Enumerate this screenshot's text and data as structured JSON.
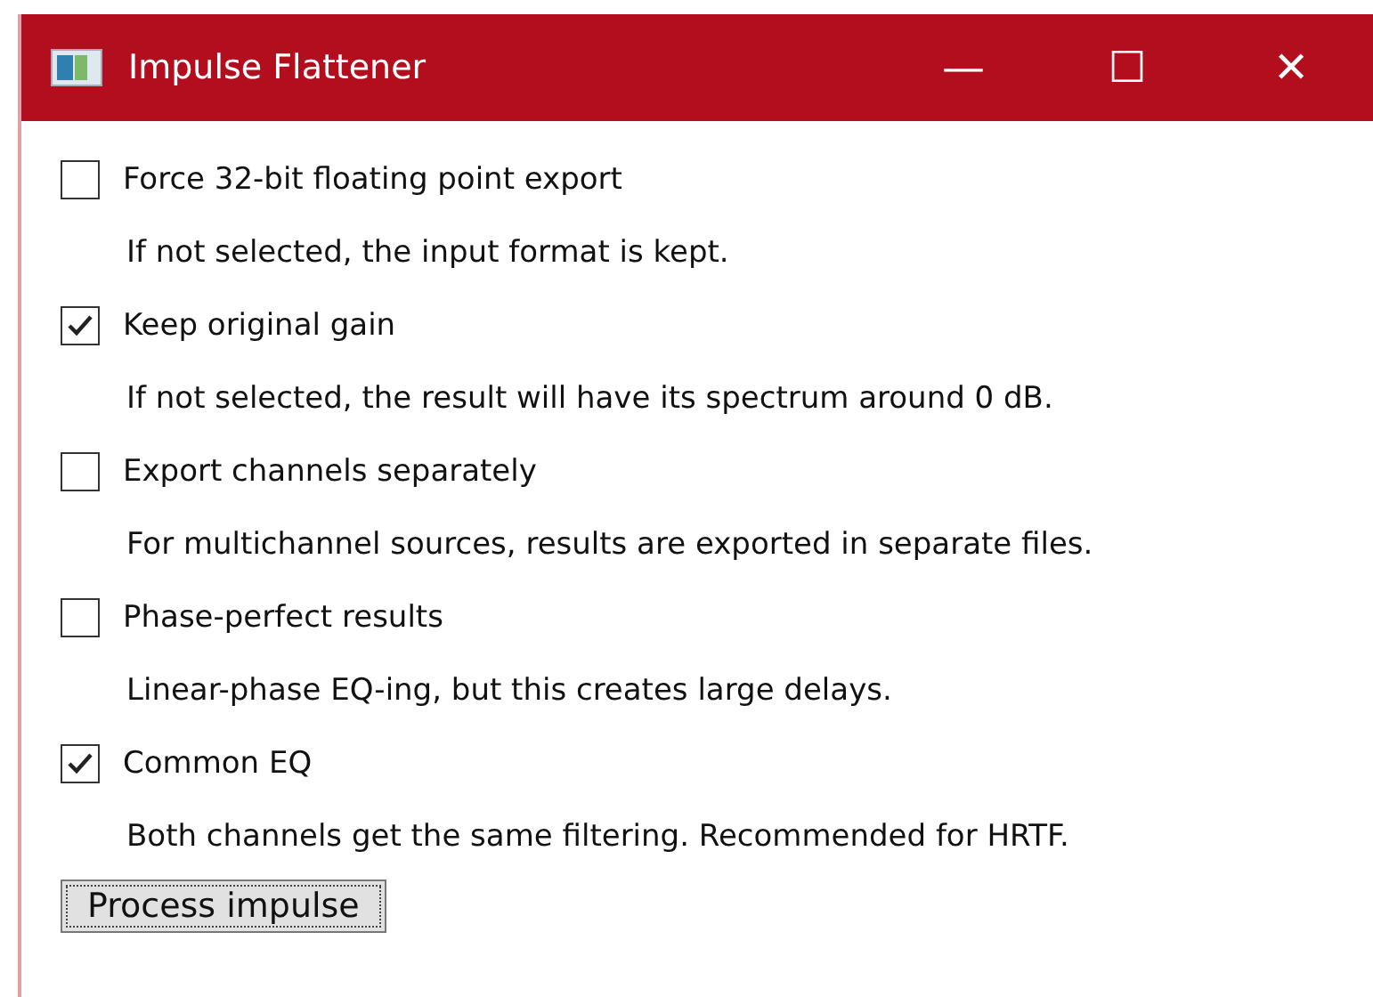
{
  "window": {
    "title": "Impulse Flattener",
    "controls": [
      "—",
      "☐",
      "✕"
    ]
  },
  "options": [
    {
      "label": "Force 32-bit floating point export",
      "checked": false,
      "description": "If not selected, the input format is kept."
    },
    {
      "label": "Keep original gain",
      "checked": true,
      "description": "If not selected, the result will have its spectrum around 0 dB."
    },
    {
      "label": "Export channels separately",
      "checked": false,
      "description": "For multichannel sources, results are exported in separate files."
    },
    {
      "label": "Phase-perfect results",
      "checked": false,
      "description": "Linear-phase EQ-ing, but this creates large delays."
    },
    {
      "label": "Common EQ",
      "checked": true,
      "description": "Both channels get the same filtering. Recommended for HRTF."
    }
  ],
  "button": "Process impulse"
}
